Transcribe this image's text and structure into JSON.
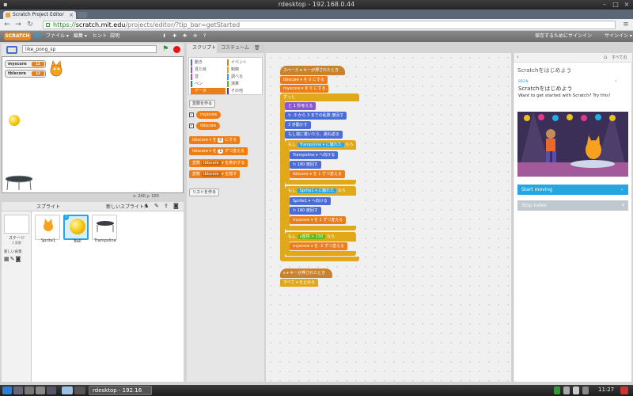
{
  "window_title": "rdesktop - 192.168.0.44",
  "browser": {
    "tab_title": "Scratch Project Editor",
    "url_scheme": "https://",
    "url_host": "scratch.mit.edu",
    "url_path": "/projects/editor/?tip_bar=getStarted"
  },
  "menu": {
    "logo": "SCRATCH",
    "file": "ファイル ▾",
    "edit": "編集 ▾",
    "hints": "ヒント",
    "about": "説明",
    "save_to_signin": "保存するためにサインイン",
    "signin": "サインイン ▾"
  },
  "stage": {
    "project_name": "like_pong_sp",
    "coords": "x: 240  y: 100",
    "monitors": [
      {
        "label": "myscore",
        "value": "12"
      },
      {
        "label": "tblscore",
        "value": "12"
      }
    ]
  },
  "sprites": {
    "header": "スプライト",
    "new_sprite": "新しいスプライト:",
    "stage_label": "ステージ",
    "stage_bg": "1 背景",
    "new_backdrop": "新しい背景",
    "items": [
      {
        "name": "Sprite1"
      },
      {
        "name": "Ball"
      },
      {
        "name": "Trampoline"
      }
    ]
  },
  "tabs": {
    "scripts": "スクリプト",
    "costumes": "コスチューム"
  },
  "categories": [
    {
      "label": "動き",
      "color": "#4a6cd4"
    },
    {
      "label": "イベント",
      "color": "#c88330"
    },
    {
      "label": "見た目",
      "color": "#8a55d7"
    },
    {
      "label": "制御",
      "color": "#e1a91a"
    },
    {
      "label": "音",
      "color": "#bb42c3"
    },
    {
      "label": "調べる",
      "color": "#2ca5e2"
    },
    {
      "label": "ペン",
      "color": "#0e9a6c"
    },
    {
      "label": "演算",
      "color": "#5cb712"
    },
    {
      "label": "データ",
      "color": "#ee7d16"
    },
    {
      "label": "その他",
      "color": "#632d99"
    }
  ],
  "palette": {
    "make_variable": "変数を作る",
    "var1": "myscore",
    "var2": "tblscore",
    "b_set_pre": "tblscore",
    "b_set_mid": "を",
    "b_set_val": "0",
    "b_set_post": "にする",
    "b_change_pre": "tblscore",
    "b_change_mid": "を",
    "b_change_val": "1",
    "b_change_post": "ずつ変える",
    "b_show_pre": "変数",
    "b_show_var": "tblscore",
    "b_show_post": "を表示する",
    "b_hide_pre": "変数",
    "b_hide_var": "tblscore",
    "b_hide_post": "を隠す",
    "make_list": "リストを作る"
  },
  "script": {
    "hat1": "スペース ▾ キーが押されたとき",
    "set1": "tblscore ▾ を 0 にする",
    "set2": "myscore ▾ を 0 にする",
    "forever": "ずっと",
    "think": "と 1 秒考える",
    "turn": "↻ -3 から 3 までの乱数 度回す",
    "move": "3 歩動かす",
    "bounce": "もし端に着いたら、跳ね返る",
    "if1": "もし",
    "if1_cond": "Trampoline ▾ に触れた",
    "if1_then": "なら",
    "point1": "Trampoline ▾ へ向ける",
    "turn180a": "↻ 180 度回す",
    "change1": "tblscore ▾ を 1 ずつ変える",
    "if2": "もし",
    "if2_cond": "Sprite1 ▾ に触れた",
    "if2_then": "なら",
    "point2": "Sprite1 ▾ へ向ける",
    "turn180b": "↻ 180 度回す",
    "change2": "myscore ▾ を 1 ずつ変える",
    "if3": "もし",
    "if3_cond": "y座標 > 150",
    "if3_then": "なら",
    "change3": "myscore ▾ を -1 ずつ変える",
    "hat2": "s ▾ キーが押されたとき",
    "stop_all": "すべて ▾ を止める"
  },
  "tips": {
    "all": "すべての",
    "title": "Scratchをはじめよう",
    "begin": "BEGIN",
    "heading": "Scratchをはじめよう",
    "desc": "Want to get started with Scratch? Try this!",
    "step1": "Start moving",
    "step2": "Stop index"
  },
  "taskbar": {
    "active": "rdesktop - 192.16",
    "time": "11:27"
  }
}
